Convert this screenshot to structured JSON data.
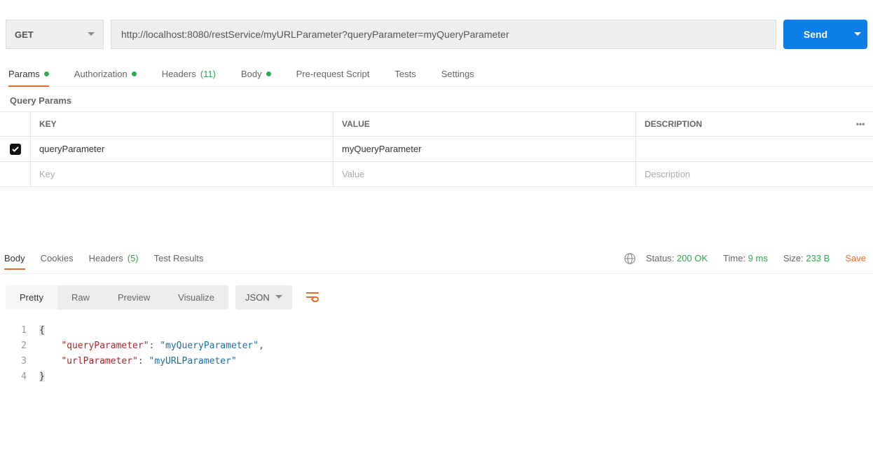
{
  "request": {
    "method": "GET",
    "url": "http://localhost:8080/restService/myURLParameter?queryParameter=myQueryParameter",
    "send_label": "Send"
  },
  "req_tabs": {
    "params": "Params",
    "authorization": "Authorization",
    "headers": "Headers",
    "headers_count": "(11)",
    "body": "Body",
    "prerequest": "Pre-request Script",
    "tests": "Tests",
    "settings": "Settings"
  },
  "params_section": {
    "title": "Query Params",
    "cols": {
      "key": "KEY",
      "value": "VALUE",
      "description": "DESCRIPTION"
    },
    "rows": [
      {
        "checked": true,
        "key": "queryParameter",
        "value": "myQueryParameter",
        "description": ""
      }
    ],
    "placeholders": {
      "key": "Key",
      "value": "Value",
      "description": "Description"
    }
  },
  "resp_tabs": {
    "body": "Body",
    "cookies": "Cookies",
    "headers": "Headers",
    "headers_count": "(5)",
    "test_results": "Test Results"
  },
  "meta": {
    "status_label": "Status:",
    "status_value": "200 OK",
    "time_label": "Time:",
    "time_value": "9 ms",
    "size_label": "Size:",
    "size_value": "233 B",
    "save": "Save"
  },
  "resp_toolbar": {
    "pretty": "Pretty",
    "raw": "Raw",
    "preview": "Preview",
    "visualize": "Visualize",
    "format": "JSON"
  },
  "response_body": {
    "lines": [
      {
        "n": "1",
        "tokens": [
          {
            "t": "brace",
            "v": "{"
          }
        ]
      },
      {
        "n": "2",
        "tokens": [
          {
            "t": "indent",
            "v": "    "
          },
          {
            "t": "key",
            "v": "\"queryParameter\""
          },
          {
            "t": "colon",
            "v": ": "
          },
          {
            "t": "str",
            "v": "\"myQueryParameter\""
          },
          {
            "t": "punct",
            "v": ","
          }
        ]
      },
      {
        "n": "3",
        "tokens": [
          {
            "t": "indent",
            "v": "    "
          },
          {
            "t": "key",
            "v": "\"urlParameter\""
          },
          {
            "t": "colon",
            "v": ": "
          },
          {
            "t": "str",
            "v": "\"myURLParameter\""
          }
        ]
      },
      {
        "n": "4",
        "tokens": [
          {
            "t": "brace",
            "v": "}"
          }
        ]
      }
    ]
  }
}
